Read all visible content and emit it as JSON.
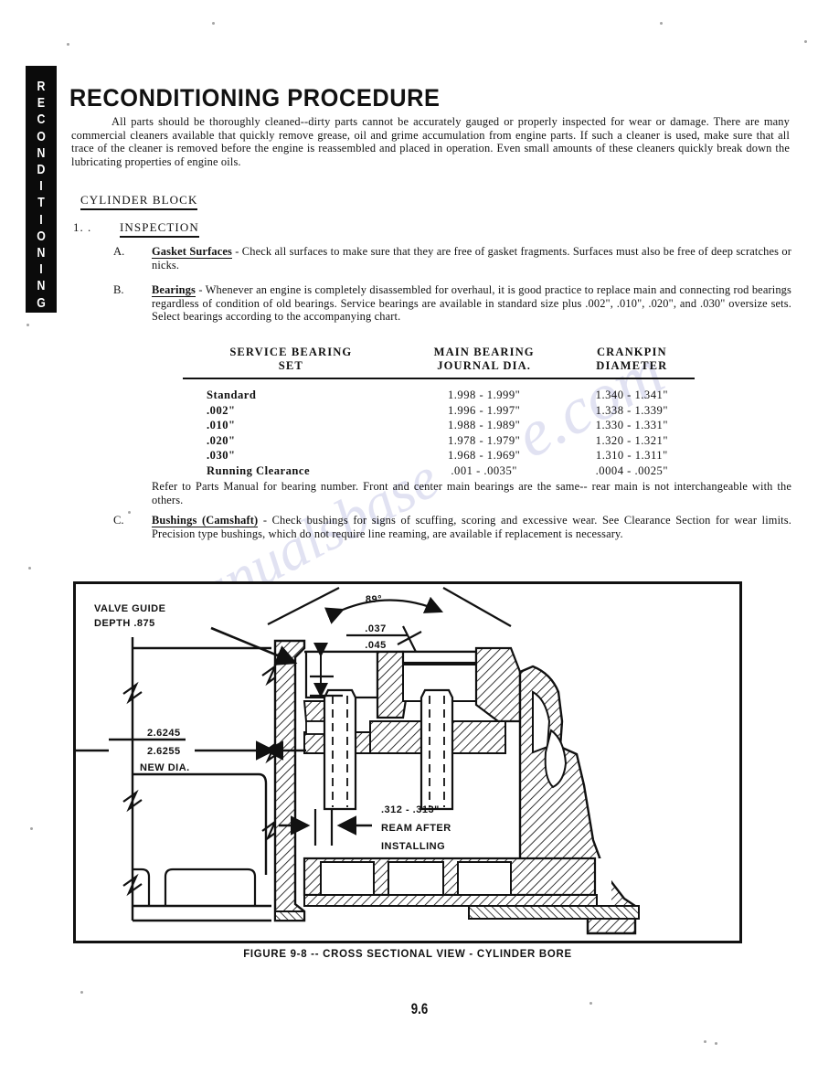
{
  "tab": {
    "label": "R\nE\nC\nO\nN\nD\nI\nT\nI\nO\nN\nI\nN\nG"
  },
  "title": "RECONDITIONING  PROCEDURE",
  "intro_paragraph": "All parts should be thoroughly cleaned--dirty parts cannot be accurately gauged or properly inspected for wear or damage.  There are many commercial cleaners available that quickly remove grease, oil and grime accumulation from engine parts.  If such a cleaner is used, make sure that all trace of the cleaner is removed before the engine is reassembled and placed in operation.  Even small amounts of these cleaners quickly break down the lubricating properties of engine oils.",
  "sections": {
    "cylinder_block_heading": "CYLINDER BLOCK",
    "inspection_number": "1. .",
    "inspection_heading": "INSPECTION"
  },
  "items": [
    {
      "letter": "A.",
      "term": "Gasket Surfaces",
      "text": " - Check all surfaces to make sure that they are free of gasket fragments. Surfaces must also be free of deep scratches or nicks."
    },
    {
      "letter": "B.",
      "term": "Bearings",
      "text": " - Whenever an engine is completely disassembled for overhaul, it is good practice to replace main and connecting rod bearings regardless of condition of old bearings.  Service bearings are available in standard size plus .002\", .010\", .020\", and .030\" oversize sets.  Select bearings according to the accompanying chart."
    },
    {
      "letter": "C.",
      "term": "Bushings (Camshaft)",
      "text": " - Check bushings for signs of scuffing, scoring and excessive wear. See Clearance Section for wear limits.  Precision type bushings, which do not require line reaming, are available if replacement is necessary."
    }
  ],
  "refer_note": "Refer to Parts Manual for bearing number.  Front and center main bearings are the same-- rear main is not interchangeable with the others.",
  "bearing_table": {
    "columns": [
      "SERVICE BEARING\nSET",
      "MAIN BEARING\nJOURNAL DIA.",
      "CRANKPIN\nDIAMETER"
    ],
    "rows": [
      [
        "Standard",
        "1.998 - 1.999\"",
        "1.340 - 1.341\""
      ],
      [
        ".002\"",
        "1.996 - 1.997\"",
        "1.338 - 1.339\""
      ],
      [
        ".010\"",
        "1.988 - 1.989\"",
        "1.330 - 1.331\""
      ],
      [
        ".020\"",
        "1.978 - 1.979\"",
        "1.320 - 1.321\""
      ],
      [
        ".030\"",
        "1.968 - 1.969\"",
        "1.310 - 1.311\""
      ],
      [
        "Running Clearance",
        ".001 - .0035\"",
        ".0004 - .0025\""
      ]
    ]
  },
  "figure": {
    "caption": "FIGURE 9-8 -- CROSS SECTIONAL VIEW - CYLINDER BORE",
    "annotations": {
      "valve_guide_line1": "VALVE GUIDE",
      "valve_guide_line2": "DEPTH .875",
      "angle": "89°",
      "clearance_upper": ".037",
      "clearance_lower": ".045",
      "bore_upper": "2.6245",
      "bore_lower": "2.6255",
      "bore_note": "NEW DIA.",
      "ream_dim": ".312 - .313\"",
      "ream_line1": "REAM AFTER",
      "ream_line2": "INSTALLING"
    }
  },
  "page_number": "9.6",
  "watermark": "manualsbase.com"
}
